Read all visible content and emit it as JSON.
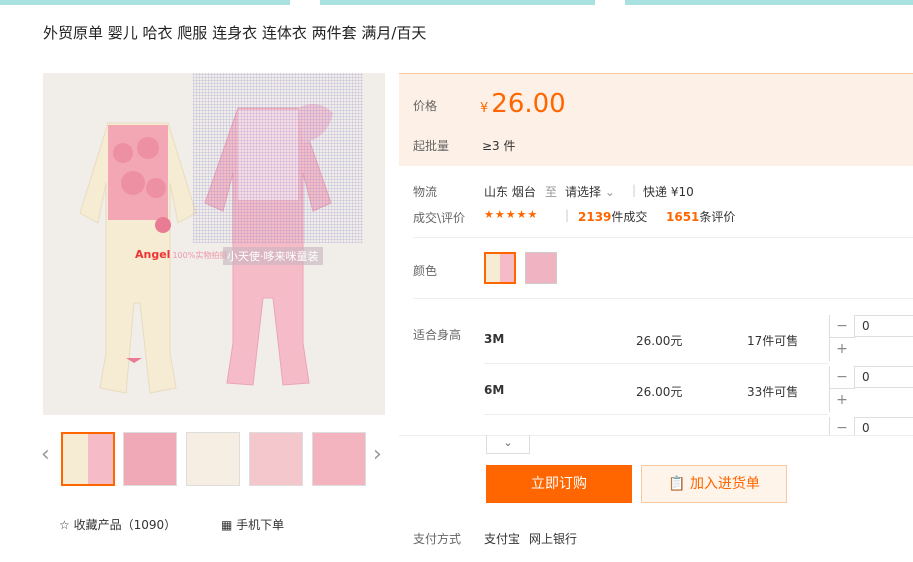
{
  "title": "外贸原单 婴儿 哈衣 爬服 连身衣 连体衣 两件套 满月/百天",
  "colors": {
    "accent": "#ff6600",
    "price_bg": "#fdf0e6"
  },
  "watermark": {
    "brand": "Angel",
    "sub": "100%实物拍摄",
    "cn": "小天使·哆来咪童装"
  },
  "gallery": {
    "prev_icon": "chevron-left-icon",
    "next_icon": "chevron-right-icon"
  },
  "collect": {
    "label": "收藏产品（1090）"
  },
  "mobile": {
    "label": "手机下单"
  },
  "price": {
    "label": "价格",
    "currency": "¥",
    "value": "26.00"
  },
  "moq": {
    "label": "起批量",
    "value": "≥3 件"
  },
  "logistics": {
    "label": "物流",
    "origin": "山东 烟台",
    "to": "至",
    "dest": "请选择",
    "express": "快递 ¥10"
  },
  "deals": {
    "label": "成交\\评价",
    "stars": "★★★★★",
    "sold_count": "2139",
    "sold_unit": "件成交",
    "review_count": "1651",
    "review_unit": "条评价"
  },
  "color": {
    "label": "颜色"
  },
  "sizes": {
    "label": "适合身高",
    "rows": [
      {
        "size": "3M",
        "price": "26.00元",
        "stock": "17件可售",
        "qty": "0"
      },
      {
        "size": "6M",
        "price": "26.00元",
        "stock": "33件可售",
        "qty": "0"
      },
      {
        "size": "",
        "price": "",
        "stock": "",
        "qty": "0"
      }
    ]
  },
  "buttons": {
    "buy": "立即订购",
    "cart": "加入进货单"
  },
  "payment": {
    "label": "支付方式",
    "alipay": "支付宝",
    "bank": "网上银行"
  }
}
